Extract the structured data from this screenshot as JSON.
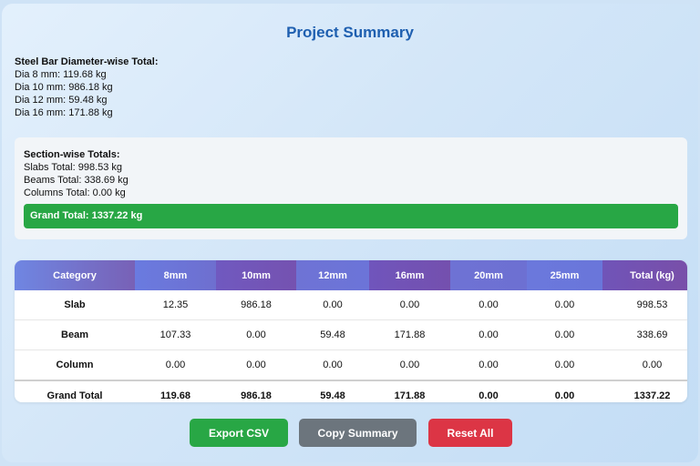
{
  "title": "Project Summary",
  "diameter_section": {
    "heading": "Steel Bar Diameter-wise Total:",
    "lines": [
      "Dia 8 mm: 119.68 kg",
      "Dia 10 mm: 986.18 kg",
      "Dia 12 mm: 59.48 kg",
      "Dia 16 mm: 171.88 kg"
    ]
  },
  "section_totals": {
    "heading": "Section-wise Totals:",
    "lines": [
      "Slabs Total: 998.53 kg",
      "Beams Total: 338.69 kg",
      "Columns Total: 0.00 kg"
    ],
    "grand_total": "Grand Total: 1337.22 kg",
    "grand_color": "#28a745"
  },
  "table": {
    "headers": [
      "Category",
      "8mm",
      "10mm",
      "12mm",
      "16mm",
      "20mm",
      "25mm",
      "Total (kg)"
    ],
    "rows": [
      [
        "Slab",
        "12.35",
        "986.18",
        "0.00",
        "0.00",
        "0.00",
        "0.00",
        "998.53"
      ],
      [
        "Beam",
        "107.33",
        "0.00",
        "59.48",
        "171.88",
        "0.00",
        "0.00",
        "338.69"
      ],
      [
        "Column",
        "0.00",
        "0.00",
        "0.00",
        "0.00",
        "0.00",
        "0.00",
        "0.00"
      ],
      [
        "Grand Total",
        "119.68",
        "986.18",
        "59.48",
        "171.88",
        "0.00",
        "0.00",
        "1337.22"
      ]
    ]
  },
  "buttons": {
    "export": "Export CSV",
    "copy": "Copy Summary",
    "reset": "Reset All"
  },
  "colors": {
    "title": "#1e5fb0",
    "export": "#28a745",
    "copy": "#6c757d",
    "reset": "#dc3545",
    "header_start": "#6f7fe0",
    "header_end": "#7656ad"
  }
}
